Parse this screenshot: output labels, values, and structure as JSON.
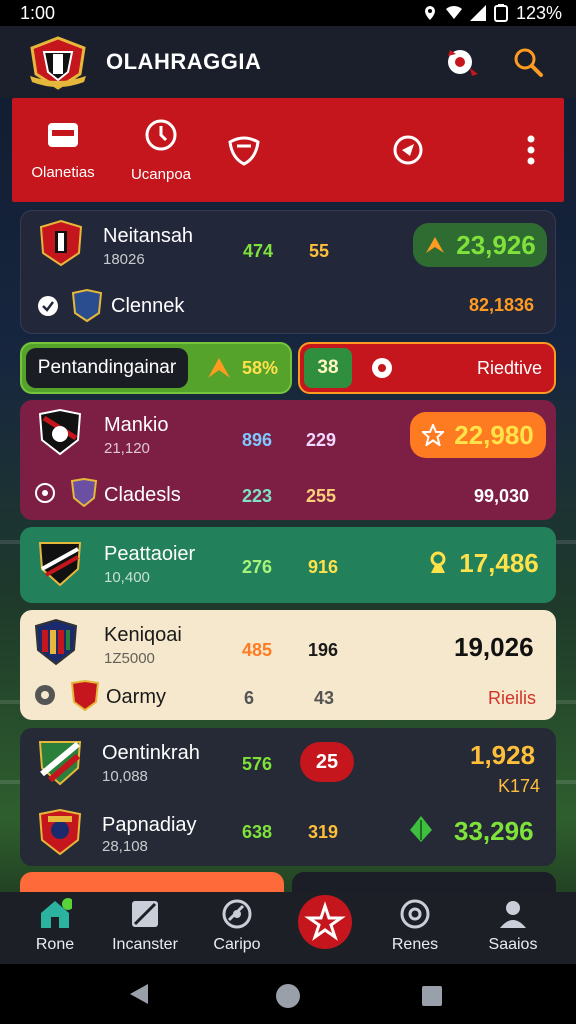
{
  "status_bar": {
    "time": "1:00",
    "battery": "123%"
  },
  "header": {
    "title": "OLAHRAGGIA"
  },
  "top_tabs": [
    {
      "label": "Olanetias",
      "icon": "card-icon"
    },
    {
      "label": "Ucanpoa",
      "icon": "clock-icon"
    },
    {
      "label": "",
      "icon": "shield-heart-icon"
    },
    {
      "label": "",
      "icon": "target-icon"
    },
    {
      "label": "",
      "icon": "more-vertical-icon"
    }
  ],
  "matches": [
    {
      "team1": {
        "name": "Neitansah",
        "sub": "18026",
        "stat1": "474",
        "stat2": "55",
        "value": "23,926"
      },
      "team2": {
        "name": "Clennek",
        "sub": "",
        "value": "82,1836"
      }
    }
  ],
  "promo": {
    "label": "Pentandingainar",
    "percent": "58%",
    "count": "38",
    "right_label": "Riedtive"
  },
  "card2": {
    "team1": {
      "name": "Mankio",
      "sub": "21,120",
      "stat1": "896",
      "stat2": "229",
      "value": "22,980"
    },
    "team2": {
      "name": "Cladesls",
      "stat1": "223",
      "stat2": "255",
      "value": "99,030"
    }
  },
  "card3": {
    "name": "Peattaoier",
    "sub": "10,400",
    "stat1": "276",
    "stat2": "916",
    "value": "17,486"
  },
  "card4": {
    "team1": {
      "name": "Keniqoai",
      "sub": "1Z5000",
      "stat1": "485",
      "stat2": "196",
      "value": "19,026"
    },
    "team2": {
      "name": "Oarmy",
      "stat1": "6",
      "stat2": "43",
      "value": "Rieilis"
    }
  },
  "card5": {
    "team1": {
      "name": "Oentinkrah",
      "sub": "10,088",
      "stat1": "576",
      "badge": "25",
      "value": "1,928",
      "value2": "K174"
    },
    "team2": {
      "name": "Papnadiay",
      "sub": "28,108",
      "stat1": "638",
      "stat2": "319",
      "value": "33,296"
    }
  },
  "bottom_nav": [
    {
      "label": "Rone",
      "icon": "home-icon"
    },
    {
      "label": "Incanster",
      "icon": "pitch-icon"
    },
    {
      "label": "Caripo",
      "icon": "ball-icon"
    },
    {
      "label": "",
      "icon": "star-center-icon"
    },
    {
      "label": "Renes",
      "icon": "target-nav-icon"
    },
    {
      "label": "Saaios",
      "icon": "profile-icon"
    }
  ],
  "colors": {
    "red": "#c4161c",
    "green": "#2b9a57",
    "maroon": "#7d1f44",
    "cream": "#f5e8cc",
    "orange": "#ff9b20",
    "lime": "#7fe23a"
  }
}
